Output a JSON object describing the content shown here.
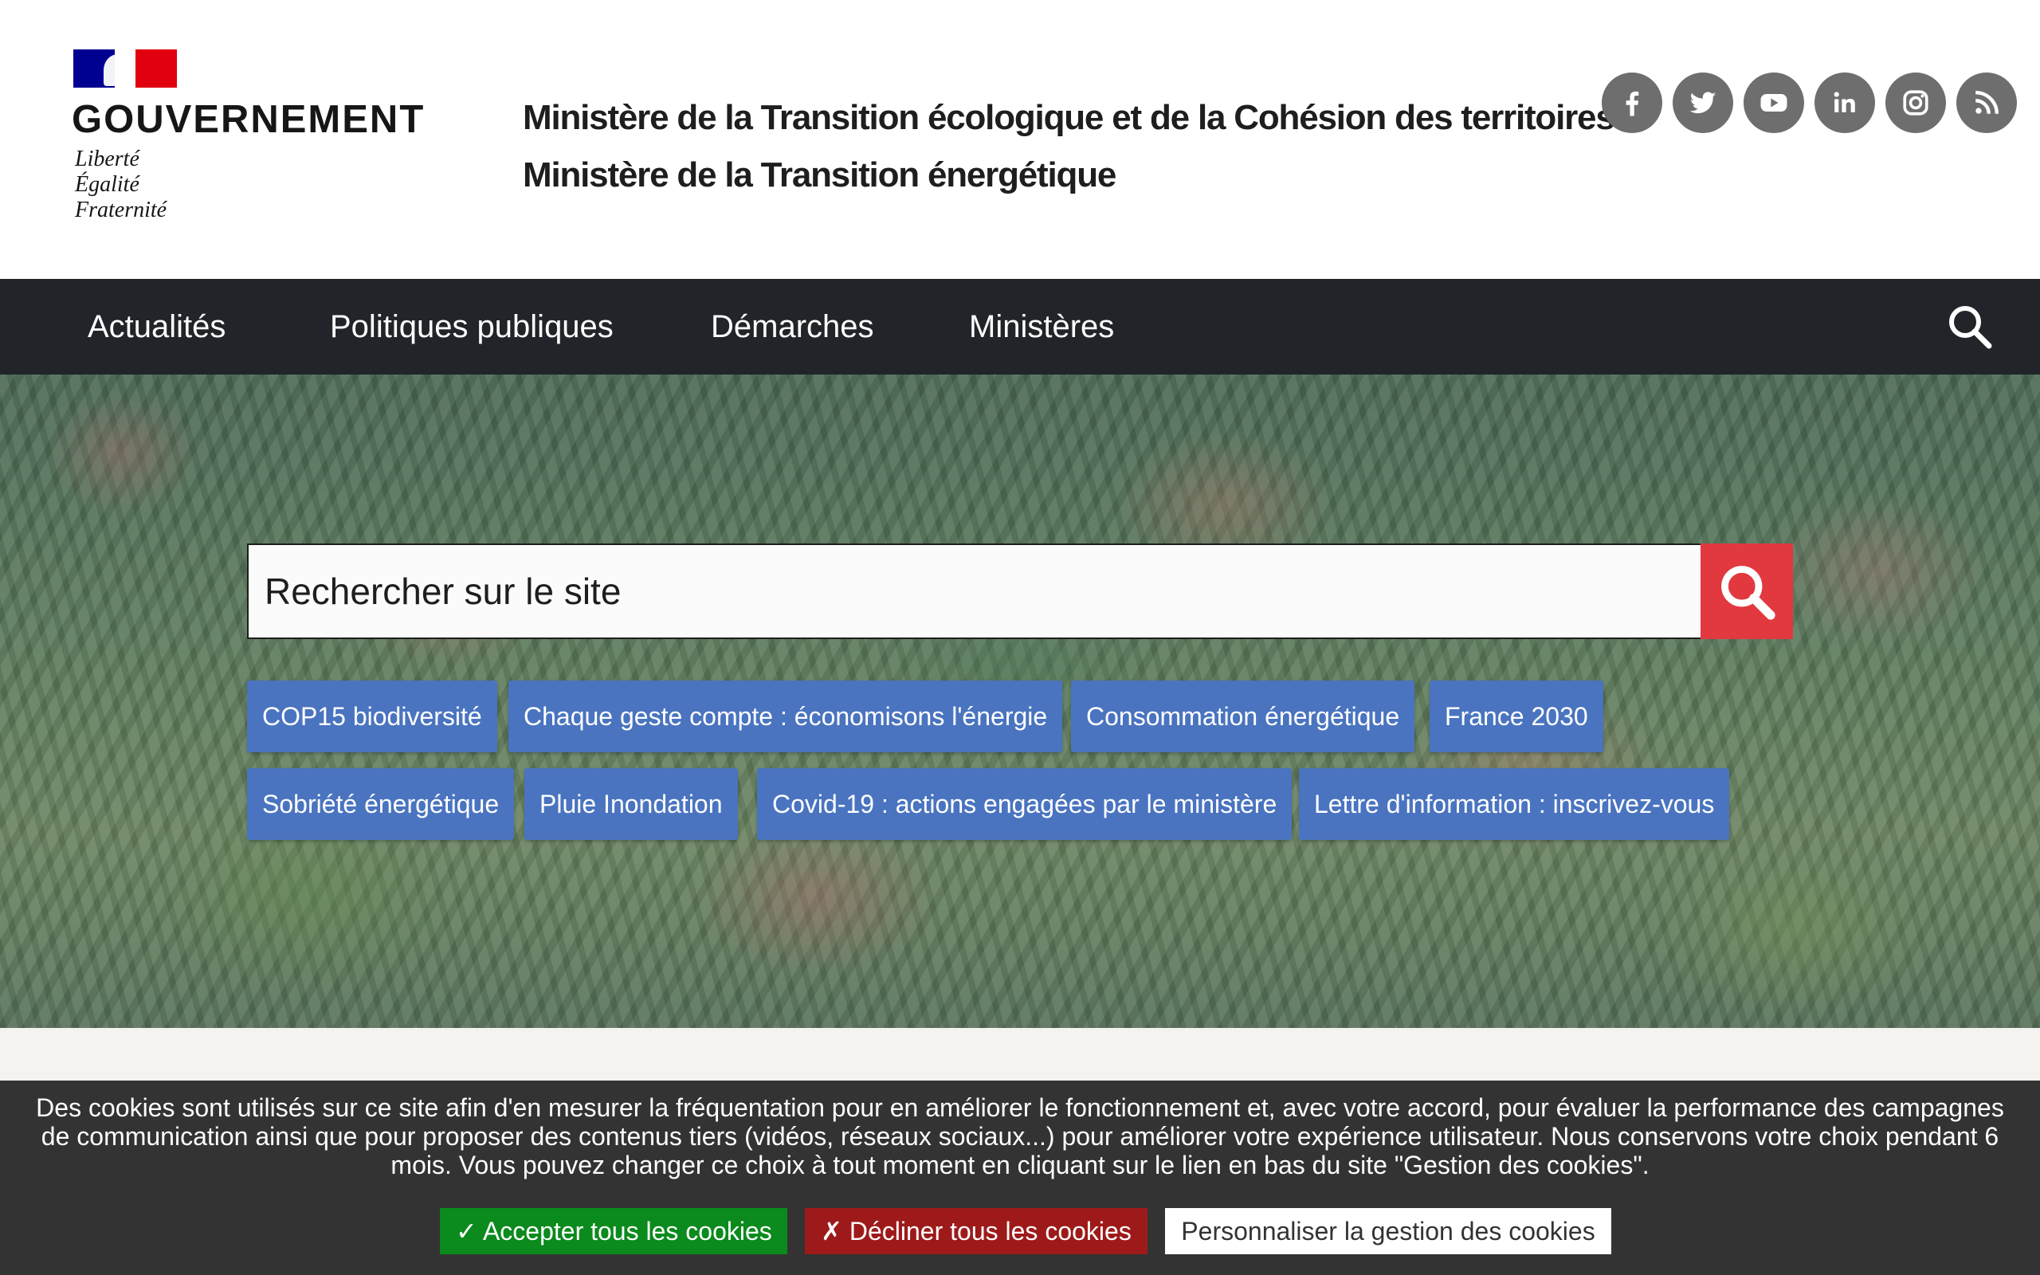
{
  "header": {
    "logo": {
      "name": "GOUVERNEMENT",
      "motto": [
        "Liberté",
        "Égalité",
        "Fraternité"
      ]
    },
    "ministries": [
      "Ministère de la Transition écologique et de la Cohésion des territoires",
      "Ministère de la Transition énergétique"
    ],
    "socials": [
      {
        "icon": "facebook-icon"
      },
      {
        "icon": "twitter-icon"
      },
      {
        "icon": "youtube-icon"
      },
      {
        "icon": "linkedin-icon"
      },
      {
        "icon": "instagram-icon"
      },
      {
        "icon": "rss-icon"
      }
    ]
  },
  "nav": {
    "items": [
      "Actualités",
      "Politiques publiques",
      "Démarches",
      "Ministères"
    ],
    "search_icon": "search-icon"
  },
  "hero": {
    "search": {
      "placeholder": "Rechercher sur le site",
      "button_icon": "search-icon"
    },
    "tags": [
      "COP15 biodiversité",
      "Chaque geste compte : économisons l'énergie",
      "Consommation énergétique",
      "France 2030",
      "Sobriété énergétique",
      "Pluie Inondation",
      "Covid-19 : actions engagées par le ministère",
      "Lettre d'information : inscrivez-vous"
    ]
  },
  "cookie_banner": {
    "text": "Des cookies sont utilisés sur ce site afin d'en mesurer la fréquentation pour en améliorer le fonctionnement et, avec votre accord, pour évaluer la performance des campagnes de communication ainsi que pour proposer des contenus tiers (vidéos, réseaux sociaux...) pour améliorer votre expérience utilisateur. Nous conservons votre choix pendant 6 mois. Vous pouvez changer ce choix à tout moment en cliquant sur le lien en bas du site \"Gestion des cookies\".",
    "accept_label": "✓ Accepter tous les cookies",
    "decline_label": "✗ Décliner tous les cookies",
    "customize_label": "Personnaliser la gestion des cookies"
  },
  "colors": {
    "nav_bg": "#212429",
    "tag_bg": "#4a74c0",
    "search_button": "#e1393f",
    "accept": "#0b8a1d",
    "decline": "#9e1a1a",
    "cookie_bg": "#333333"
  }
}
